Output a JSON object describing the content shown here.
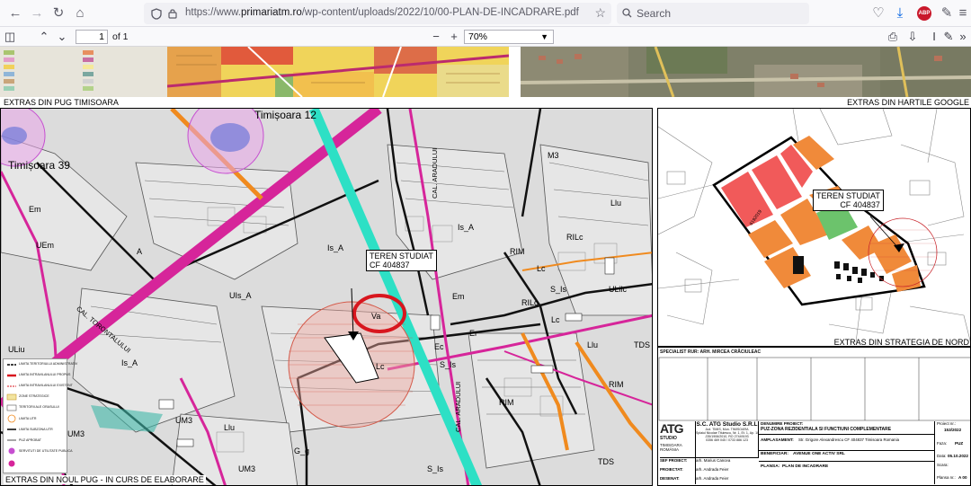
{
  "browser": {
    "url_prefix": "https://www.",
    "url_domain": "primariatm.ro",
    "url_path": "/wp-content/uploads/2022/10/00-PLAN-DE-INCADRARE.pdf",
    "search_placeholder": "Search",
    "addon_badge": "ABP"
  },
  "pdf": {
    "page_current": "1",
    "page_total": "of 1",
    "zoom": "70%"
  },
  "doc": {
    "section_pug": "EXTRAS DIN PUG TIMISOARA",
    "section_google": "EXTRAS DIN HARTILE GOOGLE",
    "section_new_pug": "EXTRAS DIN NOUL PUG - IN CURS DE ELABORARE",
    "section_strategy": "EXTRAS DIN STRATEGIA DE NORD",
    "left_map": {
      "place_1": "Timișoara 39",
      "place_2": "Timișoara 12",
      "zones": [
        "Em",
        "UEm",
        "A",
        "Is_A",
        "UIs_A",
        "ULiu",
        "M3",
        "Is_A",
        "Llu",
        "RIM",
        "RILc",
        "Lc",
        "ULilc",
        "Em",
        "Ec",
        "Er",
        "RILc",
        "S_Is",
        "Lc",
        "Llu",
        "TDS",
        "S_Is",
        "Lc",
        "Va",
        "Is_A",
        "RIM",
        "RIM",
        "UM3",
        "UM3",
        "Llu",
        "G_g",
        "UM3",
        "S_Is",
        "TDS"
      ],
      "street_1": "CAL. TORONTALULUI",
      "street_2": "CAL. ARADULUI",
      "street_3": "CAL. ARADULUI",
      "site_label_1": "TEREN STUDIAT",
      "site_label_2": "CF 404837",
      "legend": [
        "LIMITA TERITORIULUI ADMINISTRATIV",
        "LIMITA INTRAVILANULUI PROPUS",
        "LIMITA INTRAVILANULUI EXISTENT",
        "ZONE STRATEGICE",
        "TERITORII ALE ORASULUI",
        "LIMITA UTR",
        "LIMITA SUBZONA UTR",
        "PUZ APROBAT",
        "SERVITUTI DE UTILITATE PUBLICA"
      ]
    },
    "right_map": {
      "site_label_1": "TEREN STUDIAT",
      "site_label_2": "CF 404837"
    },
    "specialist": "SPECIALIST RUR: ARH. MIRCEA CRĂCIULEAC",
    "title_block": {
      "logo_main": "ATG",
      "logo_sub1": "STUDIO",
      "logo_sub2": "TIMISOARA",
      "logo_sub3": "ROMÂNIA",
      "company": "S.C. ATG Studio S.R.L",
      "company_addr_1": "Jud. TIMIS, Mun. TIMISOARA",
      "company_addr_2": "Splaiul Nicolae Titulescu, Nr. 1, Et. 1, Ap. 10",
      "company_addr_3": "J35/1906/2010, RO 27449193",
      "company_addr_4": "0356 469 045 / 0733 886 123",
      "project_label": "DENUMIRE PROIECT:",
      "project_name": "PUZ-ZONA REZIDENTIALA SI FUNCTIUNI COMPLEMENTARE",
      "location_label": "AMPLASAMENT:",
      "location": "Str. Grigore Alexandrescu CF 404837 Timisoara Romania",
      "beneficiary_label": "BENEFICIAR:",
      "beneficiary": "AVENUE ONE ACTIV SRL",
      "plan_label": "PLANSA:",
      "plan_name": "PLAN DE INCADRARE",
      "role_1": "SEF PROIECT:",
      "person_1": "arh. Marius Cancea",
      "role_2": "PROIECTAT:",
      "person_2": "arh. Andrada Feier",
      "role_3": "DESENAT:",
      "person_3": "arh. Andrada Feier",
      "project_nr_label": "Proiect nr.:",
      "project_nr": "153/2022",
      "phase_label": "Faza:",
      "phase": "PUZ",
      "date_label": "Data:",
      "date": "05.10.2022",
      "scale_label": "Scara:",
      "sheet_label": "Plansa nr.:",
      "sheet": "A 00"
    }
  }
}
